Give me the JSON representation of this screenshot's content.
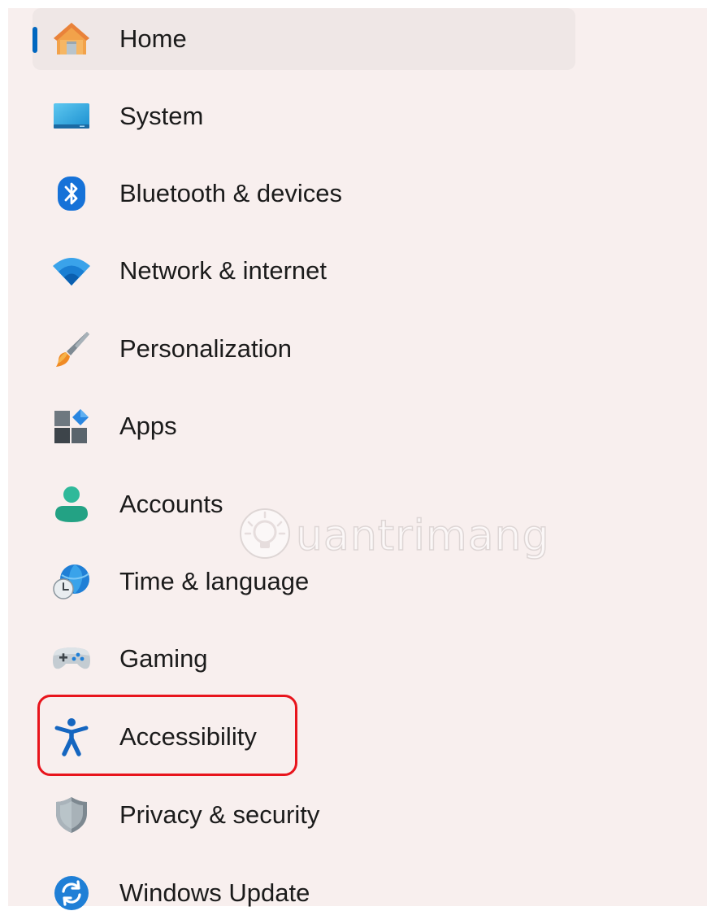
{
  "nav": {
    "items": [
      {
        "id": "home",
        "label": "Home",
        "icon": "home-icon",
        "selected": true
      },
      {
        "id": "system",
        "label": "System",
        "icon": "monitor-icon"
      },
      {
        "id": "bluetooth",
        "label": "Bluetooth & devices",
        "icon": "bluetooth-icon"
      },
      {
        "id": "network",
        "label": "Network & internet",
        "icon": "wifi-icon"
      },
      {
        "id": "personalization",
        "label": "Personalization",
        "icon": "paintbrush-icon"
      },
      {
        "id": "apps",
        "label": "Apps",
        "icon": "apps-icon"
      },
      {
        "id": "accounts",
        "label": "Accounts",
        "icon": "person-icon"
      },
      {
        "id": "time",
        "label": "Time & language",
        "icon": "globe-clock-icon"
      },
      {
        "id": "gaming",
        "label": "Gaming",
        "icon": "gamepad-icon"
      },
      {
        "id": "accessibility",
        "label": "Accessibility",
        "icon": "accessibility-icon",
        "highlighted": true
      },
      {
        "id": "privacy",
        "label": "Privacy & security",
        "icon": "shield-icon"
      },
      {
        "id": "update",
        "label": "Windows Update",
        "icon": "sync-icon"
      }
    ]
  },
  "watermark": {
    "text": "uantrimang",
    "icon": "lightbulb-logo-icon"
  },
  "colors": {
    "background": "#f8efee",
    "selected_bg": "#efe7e6",
    "accent": "#0067c0",
    "highlight": "#e8141c"
  }
}
